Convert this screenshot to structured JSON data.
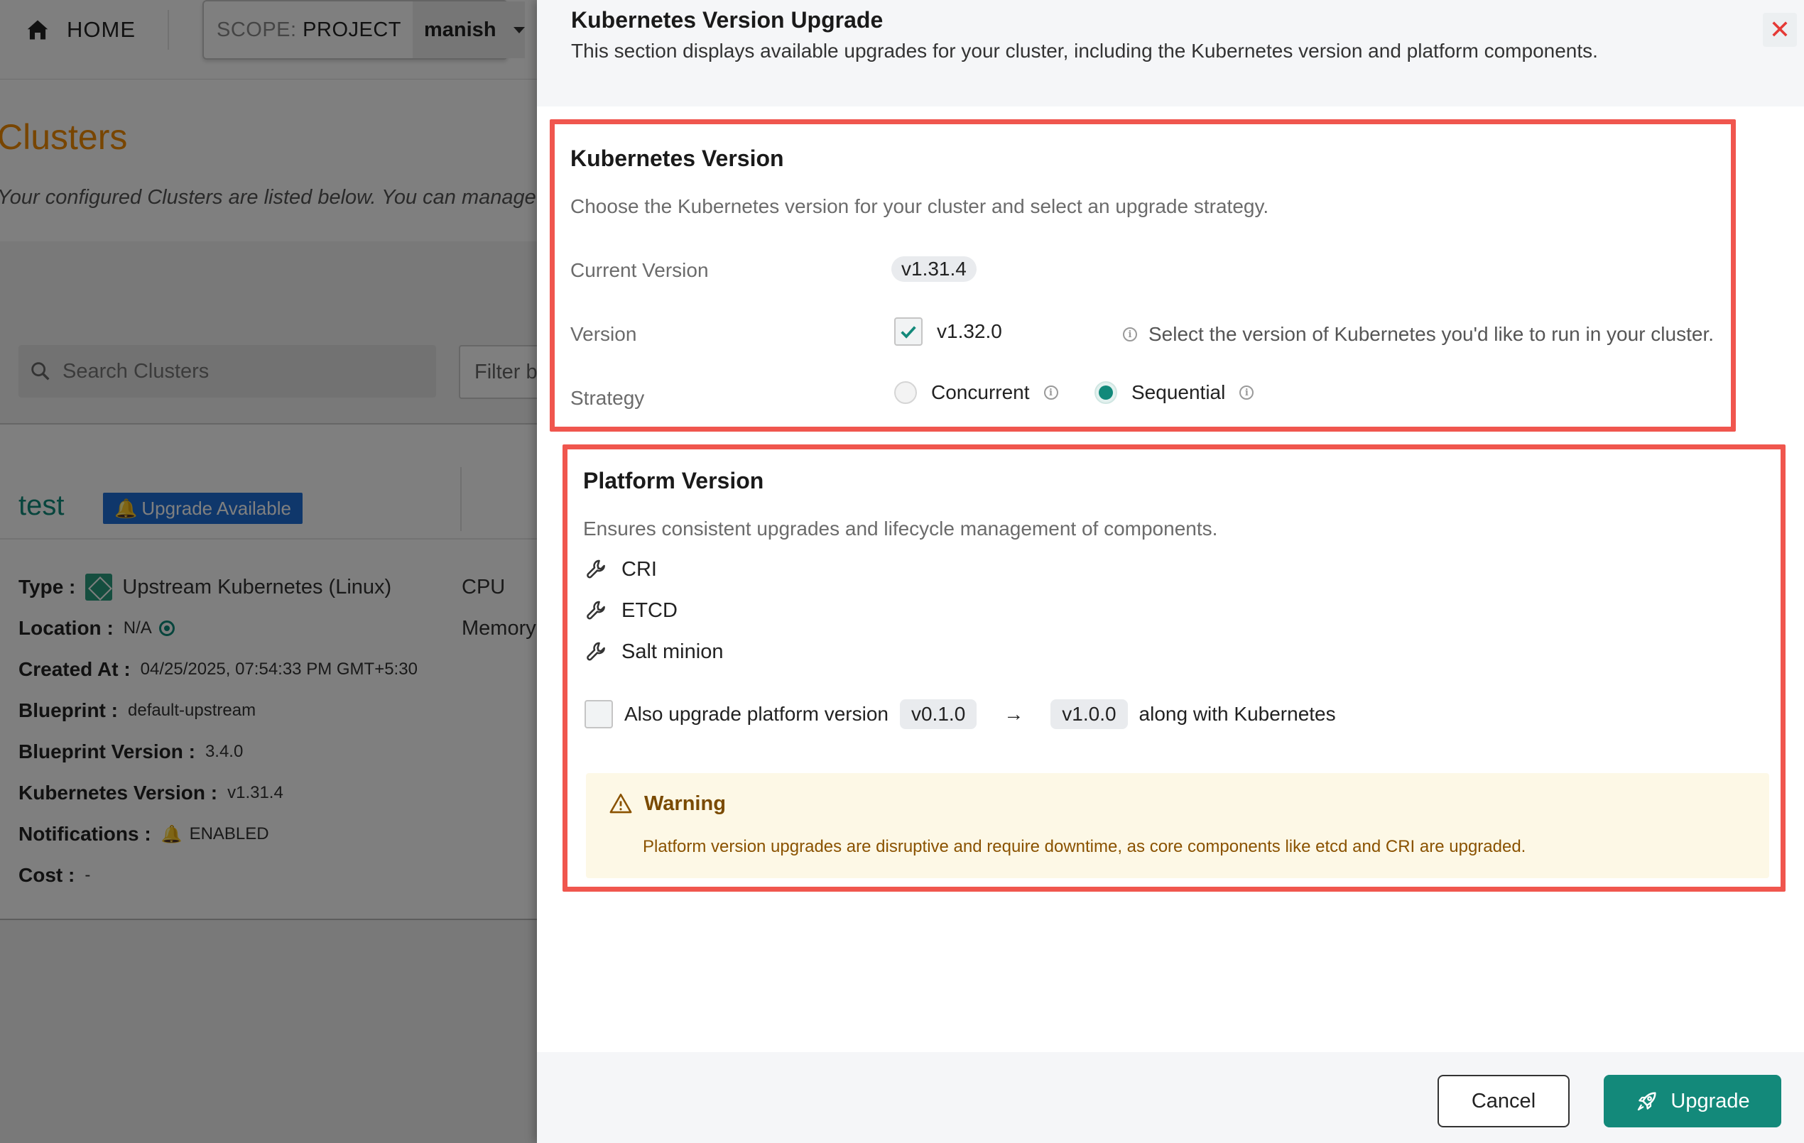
{
  "topbar": {
    "home_label": "HOME",
    "scope_prefix": "SCOPE:",
    "scope_type": "PROJECT",
    "scope_value": "manish"
  },
  "background": {
    "title": "Clusters",
    "subtitle": "Your configured Clusters are listed below. You can manage indi",
    "search_placeholder": "Search Clusters",
    "filter_label": "Filter by",
    "cluster": {
      "name": "test",
      "badge": "Upgrade Available",
      "type_label": "Type :",
      "type_value": "Upstream Kubernetes (Linux)",
      "location_label": "Location :",
      "location_value": "N/A",
      "created_label": "Created At :",
      "created_value": "04/25/2025, 07:54:33 PM GMT+5:30",
      "blueprint_label": "Blueprint :",
      "blueprint_value": "default-upstream",
      "blueprint_version_label": "Blueprint Version :",
      "blueprint_version_value": "3.4.0",
      "k8s_version_label": "Kubernetes Version :",
      "k8s_version_value": "v1.31.4",
      "notifications_label": "Notifications :",
      "notifications_value": "ENABLED",
      "cost_label": "Cost :",
      "cost_value": "-",
      "cpu_label": "CPU",
      "memory_label": "Memory"
    }
  },
  "drawer": {
    "title": "Kubernetes Version Upgrade",
    "description": "This section displays available upgrades for your cluster, including the Kubernetes version and platform components.",
    "close_icon": "close-icon",
    "k8s_section": {
      "title": "Kubernetes Version",
      "description": "Choose the Kubernetes version for your cluster and select an upgrade strategy.",
      "current_version_label": "Current Version",
      "current_version_value": "v1.31.4",
      "version_label": "Version",
      "version_value": "v1.32.0",
      "version_checked": true,
      "version_help": "Select the version of Kubernetes you'd like to run in your cluster.",
      "strategy_label": "Strategy",
      "strategy_options": [
        "Concurrent",
        "Sequential"
      ],
      "strategy_selected": "Sequential"
    },
    "platform_section": {
      "title": "Platform Version",
      "description": "Ensures consistent upgrades and lifecycle management of components.",
      "components": [
        "CRI",
        "ETCD",
        "Salt minion"
      ],
      "also_upgrade_label": "Also upgrade platform version",
      "from_version": "v0.1.0",
      "arrow": "→",
      "to_version": "v1.0.0",
      "suffix": "along with Kubernetes",
      "also_upgrade_checked": false,
      "warning_title": "Warning",
      "warning_text": "Platform version upgrades are disruptive and require downtime, as core components like etcd and CRI are upgraded."
    },
    "footer": {
      "cancel_label": "Cancel",
      "upgrade_label": "Upgrade"
    }
  },
  "colors": {
    "accent": "#13897a",
    "highlight_border": "#f0564e",
    "warning_bg": "#fdf8e6",
    "warning_text": "#8a5200",
    "clusters_title": "#f08a00",
    "badge_bg": "#1f6fd6"
  }
}
